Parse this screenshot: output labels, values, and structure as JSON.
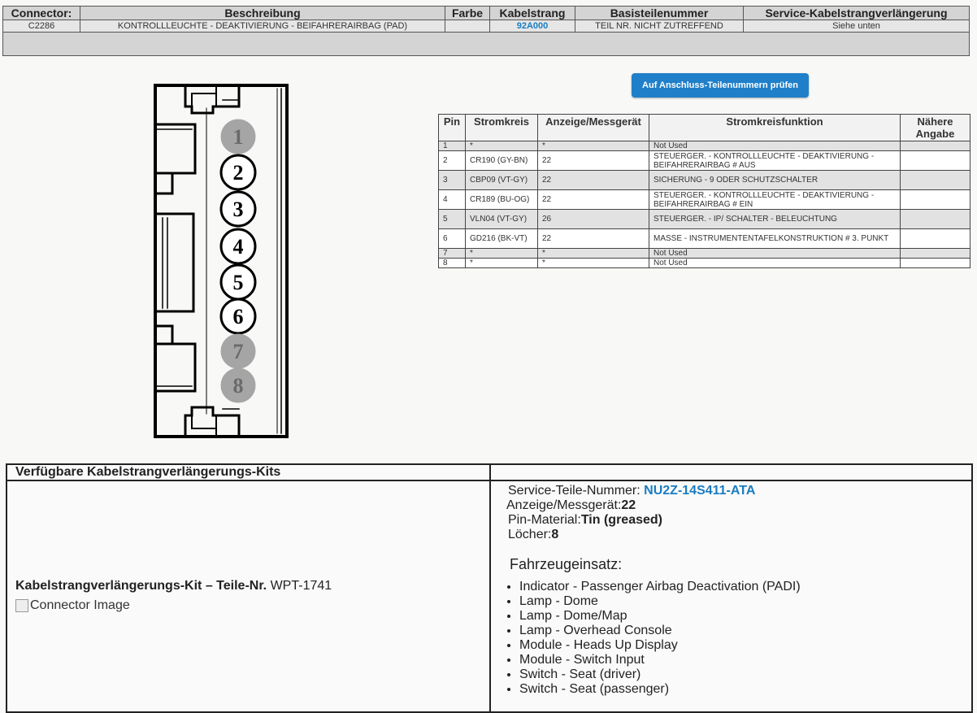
{
  "header": {
    "columns": [
      "Connector:",
      "Beschreibung",
      "Farbe",
      "Kabelstrang",
      "Basisteilenummer",
      "Service-Kabelstrangverlängerung"
    ],
    "row": {
      "connector": "C2286",
      "beschreibung": "KONTROLLLEUCHTE - DEAKTIVIERUNG - BEIFAHRERAIRBAG (PAD)",
      "farbe": "",
      "kabelstrang": "92A000",
      "basisteilenummer": "TEIL NR. NICHT ZUTREFFEND",
      "service": "Siehe unten"
    }
  },
  "diagram": {
    "pins": [
      {
        "label": "1",
        "used": false
      },
      {
        "label": "2",
        "used": true
      },
      {
        "label": "3",
        "used": true
      },
      {
        "label": "4",
        "used": true
      },
      {
        "label": "5",
        "used": true
      },
      {
        "label": "6",
        "used": true
      },
      {
        "label": "7",
        "used": false
      },
      {
        "label": "8",
        "used": false
      }
    ]
  },
  "check_button": "Auf Anschluss-Teilenummern prüfen",
  "pin_table": {
    "columns": [
      "Pin",
      "Stromkreis",
      "Anzeige/Messgerät",
      "Stromkreisfunktion",
      "Nähere Angabe"
    ],
    "rows": [
      {
        "pin": "1",
        "circuit": "*",
        "gauge": "*",
        "function": "Not Used",
        "detail": ""
      },
      {
        "pin": "2",
        "circuit": "CR190 (GY-BN)",
        "gauge": "22",
        "function": "STEUERGER. - KONTROLLLEUCHTE - DEAKTIVIERUNG - BEIFAHRERAIRBAG # AUS",
        "detail": ""
      },
      {
        "pin": "3",
        "circuit": "CBP09 (VT-GY)",
        "gauge": "22",
        "function": "SICHERUNG - 9 ODER SCHUTZSCHALTER",
        "detail": ""
      },
      {
        "pin": "4",
        "circuit": "CR189 (BU-OG)",
        "gauge": "22",
        "function": "STEUERGER. - KONTROLLLEUCHTE - DEAKTIVIERUNG - BEIFAHRERAIRBAG # EIN",
        "detail": ""
      },
      {
        "pin": "5",
        "circuit": "VLN04 (VT-GY)",
        "gauge": "26",
        "function": "STEUERGER. - IP/ SCHALTER - BELEUCHTUNG",
        "detail": ""
      },
      {
        "pin": "6",
        "circuit": "GD216 (BK-VT)",
        "gauge": "22",
        "function": "MASSE - INSTRUMENTENTAFELKONSTRUKTION # 3. PUNKT",
        "detail": ""
      },
      {
        "pin": "7",
        "circuit": "*",
        "gauge": "*",
        "function": "Not Used",
        "detail": ""
      },
      {
        "pin": "8",
        "circuit": "*",
        "gauge": "*",
        "function": "Not Used",
        "detail": ""
      }
    ]
  },
  "kits": {
    "header_left": "Verfügbare Kabelstrangverlängerungs-Kits",
    "header_right": "",
    "kit_label": "Kabelstrangverlängerungs-Kit – Teile-Nr.",
    "kit_number": "WPT-1741",
    "image_alt": "Connector Image",
    "service_part_label": "Service-Teile-Nummer:",
    "service_part_number": "NU2Z-14S411-ATA",
    "gauge_label": "Anzeige/Messgerät:",
    "gauge_value": "22",
    "pin_material_label": "Pin-Material:",
    "pin_material_value": "Tin (greased)",
    "holes_label": "Löcher:",
    "holes_value": "8",
    "usage_title": "Fahrzeugeinsatz:",
    "usage": [
      "Indicator - Passenger Airbag Deactivation (PADI)",
      "Lamp - Dome",
      "Lamp - Dome/Map",
      "Lamp - Overhead Console",
      "Module - Heads Up Display",
      "Module - Switch Input",
      "Switch - Seat (driver)",
      "Switch - Seat (passenger)"
    ]
  }
}
